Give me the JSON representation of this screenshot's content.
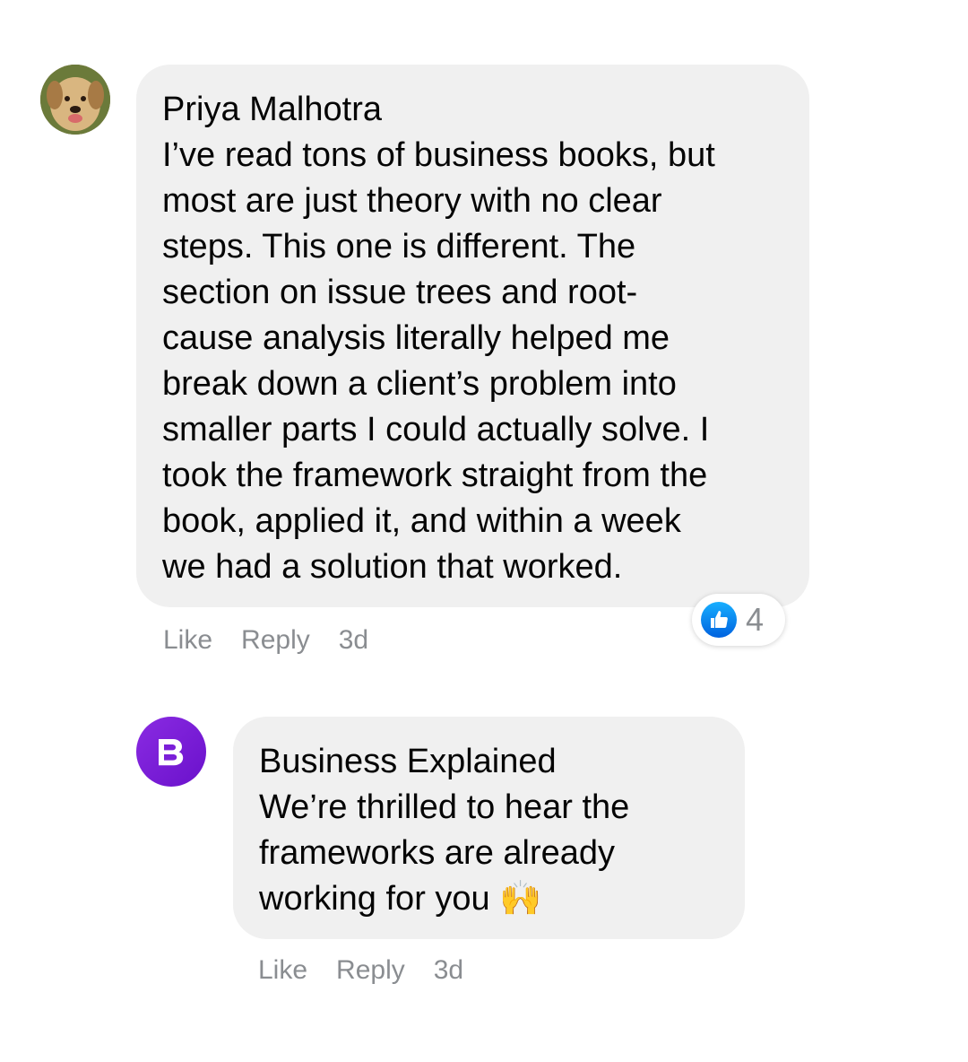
{
  "comments": [
    {
      "author": "Priya Malhotra",
      "text_lines": [
        "I’ve read tons of business books, but",
        "most are just theory with no clear",
        "steps. This one is different. The",
        "section on issue trees and root-",
        "cause analysis literally helped me",
        "break down a client’s problem into",
        "smaller parts I could actually solve. I",
        "took the framework straight from the",
        "book, applied it, and within a week",
        "we had a solution that worked."
      ],
      "actions": {
        "like": "Like",
        "reply": "Reply",
        "time": "3d"
      },
      "reaction": {
        "icon": "thumbs-up-icon",
        "count": "4",
        "color": "#0866ff"
      }
    },
    {
      "author": "Business Explained",
      "text_lines": [
        "We’re thrilled to hear the",
        "frameworks are already",
        "working for you 🙌"
      ],
      "actions": {
        "like": "Like",
        "reply": "Reply",
        "time": "3d"
      }
    }
  ],
  "colors": {
    "bubble": "#f0f0f0",
    "meta_text": "#8a8d91",
    "brand_avatar": "#7b1fd8"
  }
}
